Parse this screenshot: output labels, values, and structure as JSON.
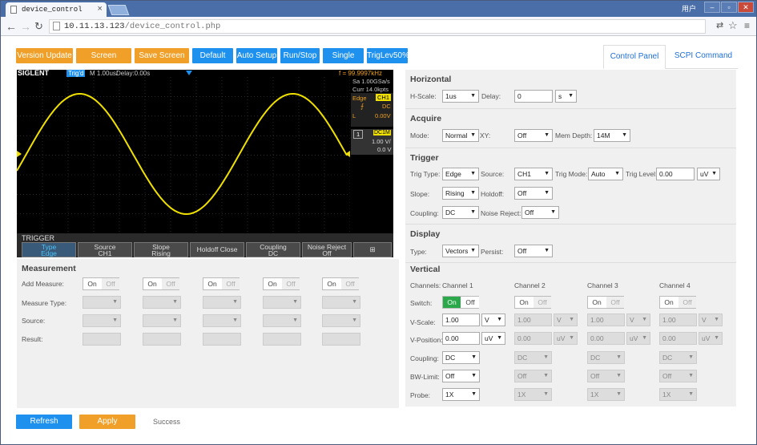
{
  "browser": {
    "tab_title": "device_control",
    "user_label": "用户",
    "url_host": "10.11.13.123",
    "url_path": "/device_control.php"
  },
  "toolbar": {
    "buttons": [
      "Version Update",
      "Screen Refresh",
      "Save Screen",
      "Default",
      "Auto Setup",
      "Run/Stop",
      "Single",
      "TrigLev50%"
    ]
  },
  "tabs": {
    "control_panel": "Control Panel",
    "scpi": "SCPI Command"
  },
  "scope": {
    "brand": "SIGLENT",
    "mode": "Trig'd",
    "timebase": "M 1.00us/",
    "delay": "Delay:0.00s",
    "freq": "f = 99.9997kHz",
    "sample": "Sa 1.00GSa/s",
    "curr": "Curr 14.0kpts",
    "trig_type": "Edge",
    "trig_src": "CH1",
    "coupling": "DC",
    "level": "0.00V",
    "ch_num": "1",
    "ch_coupling": "DC1M",
    "ch_scale": "1.00 V/",
    "ch_offset": "0.0 V",
    "trigger_label": "TRIGGER",
    "softkeys": [
      {
        "top": "Type",
        "bottom": "Edge"
      },
      {
        "top": "Source",
        "bottom": "CH1"
      },
      {
        "top": "Slope",
        "bottom": "Rising"
      },
      {
        "top": "Holdoff Close",
        "bottom": ""
      },
      {
        "top": "Coupling",
        "bottom": "DC"
      },
      {
        "top": "Noise Reject",
        "bottom": "Off"
      }
    ],
    "colors": {
      "trace": "#f0e000",
      "accent": "#1e90ee"
    }
  },
  "measurement": {
    "title": "Measurement",
    "labels": [
      "Add Measure:",
      "Measure Type:",
      "Source:",
      "Result:"
    ],
    "on": "On",
    "off": "Off"
  },
  "horizontal": {
    "title": "Horizontal",
    "hscale_label": "H-Scale:",
    "hscale": "1us",
    "delay_label": "Delay:",
    "delay": "0",
    "delay_unit": "s"
  },
  "acquire": {
    "title": "Acquire",
    "mode_label": "Mode:",
    "mode": "Normal",
    "xy_label": "XY:",
    "xy": "Off",
    "mem_label": "Mem Depth:",
    "mem": "14M"
  },
  "trigger": {
    "title": "Trigger",
    "type_label": "Trig Type:",
    "type": "Edge",
    "source_label": "Source:",
    "source": "CH1",
    "mode_label": "Trig Mode:",
    "mode": "Auto",
    "level_label": "Trig Level:",
    "level": "0.00",
    "level_unit": "uV",
    "slope_label": "Slope:",
    "slope": "Rising",
    "holdoff_label": "Holdoff:",
    "holdoff": "Off",
    "coupling_label": "Coupling:",
    "coupling": "DC",
    "noise_label": "Noise Reject:",
    "noise": "Off"
  },
  "display": {
    "title": "Display",
    "type_label": "Type:",
    "type": "Vectors",
    "persist_label": "Persist:",
    "persist": "Off"
  },
  "vertical": {
    "title": "Vertical",
    "channels_label": "Channels:",
    "switch_label": "Switch:",
    "vscale_label": "V-Scale:",
    "vpos_label": "V-Position:",
    "coupling_label": "Coupling:",
    "bw_label": "BW-Limit:",
    "probe_label": "Probe:",
    "channels": [
      {
        "name": "Channel 1",
        "vscale": "1.00",
        "vscale_unit": "V",
        "vpos": "0.00",
        "vpos_unit": "uV",
        "coupling": "DC",
        "bw": "Off",
        "probe": "1X"
      },
      {
        "name": "Channel 2",
        "vscale": "1.00",
        "vscale_unit": "V",
        "vpos": "0.00",
        "vpos_unit": "uV",
        "coupling": "DC",
        "bw": "Off",
        "probe": "1X"
      },
      {
        "name": "Channel 3",
        "vscale": "1.00",
        "vscale_unit": "V",
        "vpos": "0.00",
        "vpos_unit": "uV",
        "coupling": "DC",
        "bw": "Off",
        "probe": "1X"
      },
      {
        "name": "Channel 4",
        "vscale": "1.00",
        "vscale_unit": "V",
        "vpos": "0.00",
        "vpos_unit": "uV",
        "coupling": "DC",
        "bw": "Off",
        "probe": "1X"
      }
    ]
  },
  "footer": {
    "refresh": "Refresh",
    "apply": "Apply",
    "status": "Success"
  }
}
